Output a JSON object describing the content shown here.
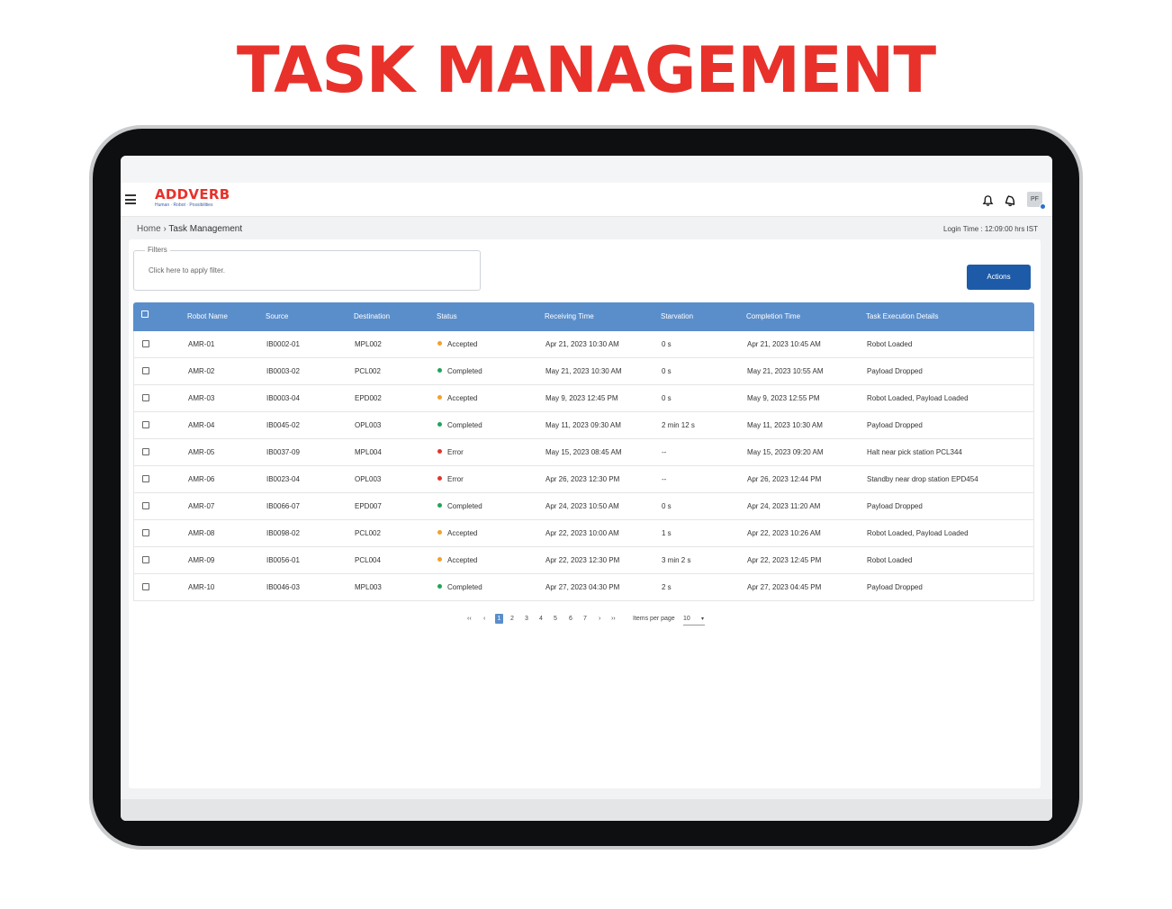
{
  "headline": "TASK MANAGEMENT",
  "brand": {
    "name": "ADDVERB",
    "tagline": "Human · Robot · Possibilities",
    "color": "#e8312a"
  },
  "user": {
    "initials": "PF"
  },
  "breadcrumb": {
    "home": "Home",
    "separator": "›",
    "current": "Task Management"
  },
  "login_time": "Login Time : 12:09:00 hrs IST",
  "filters": {
    "legend": "Filters",
    "placeholder": "Click here to apply filter."
  },
  "actions_label": "Actions",
  "columns": [
    "Robot Name",
    "Source",
    "Destination",
    "Status",
    "Receiving Time",
    "Starvation",
    "Completion Time",
    "Task Execution  Details"
  ],
  "status_colors": {
    "Accepted": "#f2a12b",
    "Completed": "#22a45a",
    "Error": "#e3342f"
  },
  "rows": [
    {
      "robot": "AMR-01",
      "source": "IB0002-01",
      "destination": "MPL002",
      "status": "Accepted",
      "receiving": "Apr 21, 2023  10:30 AM",
      "starvation": "0 s",
      "completion": "Apr 21, 2023  10:45 AM",
      "details": "Robot Loaded"
    },
    {
      "robot": "AMR-02",
      "source": "IB0003-02",
      "destination": "PCL002",
      "status": "Completed",
      "receiving": "May 21, 2023  10:30 AM",
      "starvation": "0 s",
      "completion": "May 21, 2023  10:55 AM",
      "details": "Payload Dropped"
    },
    {
      "robot": "AMR-03",
      "source": "IB0003-04",
      "destination": "EPD002",
      "status": "Accepted",
      "receiving": "May 9, 2023  12:45 PM",
      "starvation": "0 s",
      "completion": "May 9, 2023  12:55 PM",
      "details": "Robot Loaded, Payload Loaded"
    },
    {
      "robot": "AMR-04",
      "source": "IB0045-02",
      "destination": "OPL003",
      "status": "Completed",
      "receiving": "May 11, 2023  09:30 AM",
      "starvation": "2 min 12 s",
      "completion": "May 11, 2023  10:30 AM",
      "details": "Payload Dropped"
    },
    {
      "robot": "AMR-05",
      "source": "IB0037-09",
      "destination": "MPL004",
      "status": "Error",
      "receiving": "May 15, 2023  08:45 AM",
      "starvation": "--",
      "completion": "May 15, 2023  09:20 AM",
      "details": "Halt near pick station PCL344"
    },
    {
      "robot": "AMR-06",
      "source": "IB0023-04",
      "destination": "OPL003",
      "status": "Error",
      "receiving": "Apr 26, 2023  12:30 PM",
      "starvation": "--",
      "completion": "Apr 26, 2023  12:44 PM",
      "details": "Standby near drop station EPD454"
    },
    {
      "robot": "AMR-07",
      "source": "IB0066-07",
      "destination": "EPD007",
      "status": "Completed",
      "receiving": "Apr 24, 2023  10:50 AM",
      "starvation": "0 s",
      "completion": "Apr 24, 2023  11:20 AM",
      "details": "Payload Dropped"
    },
    {
      "robot": "AMR-08",
      "source": "IB0098-02",
      "destination": "PCL002",
      "status": "Accepted",
      "receiving": "Apr 22, 2023  10:00 AM",
      "starvation": "1 s",
      "completion": "Apr 22, 2023  10:26 AM",
      "details": "Robot Loaded, Payload Loaded"
    },
    {
      "robot": "AMR-09",
      "source": "IB0056-01",
      "destination": "PCL004",
      "status": "Accepted",
      "receiving": "Apr 22, 2023  12:30 PM",
      "starvation": "3 min 2 s",
      "completion": "Apr 22, 2023  12:45 PM",
      "details": "Robot Loaded"
    },
    {
      "robot": "AMR-10",
      "source": "IB0046-03",
      "destination": "MPL003",
      "status": "Completed",
      "receiving": "Apr 27, 2023  04:30 PM",
      "starvation": "2 s",
      "completion": "Apr 27, 2023  04:45 PM",
      "details": "Payload Dropped"
    }
  ],
  "pagination": {
    "first": "‹‹",
    "prev": "‹",
    "next": "›",
    "last": "››",
    "pages": [
      "1",
      "2",
      "3",
      "4",
      "5",
      "6",
      "7"
    ],
    "current_page": "1",
    "items_per_page_label": "Items per page",
    "items_per_page": "10",
    "caret": "▾"
  }
}
